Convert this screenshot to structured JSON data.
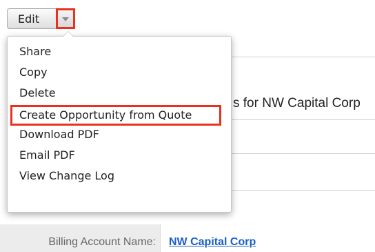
{
  "toolbar": {
    "edit_label": "Edit",
    "actions_caret_icon": "chevron-down-icon"
  },
  "actions_menu": {
    "items": [
      {
        "label": "Share"
      },
      {
        "label": "Copy"
      },
      {
        "label": "Delete"
      },
      {
        "label": "Create Opportunity from Quote",
        "highlighted": true
      },
      {
        "label": "Download PDF"
      },
      {
        "label": "Email PDF"
      },
      {
        "label": "View Change Log"
      }
    ]
  },
  "record": {
    "partial_title_text": "s for NW Capital Corp",
    "billing_account": {
      "label": "Billing Account Name:",
      "value": "NW Capital Corp"
    }
  },
  "colors": {
    "highlight_border": "#e8321e",
    "link": "#1a5ec5",
    "label_text": "#666666",
    "label_bg": "#ececec"
  }
}
